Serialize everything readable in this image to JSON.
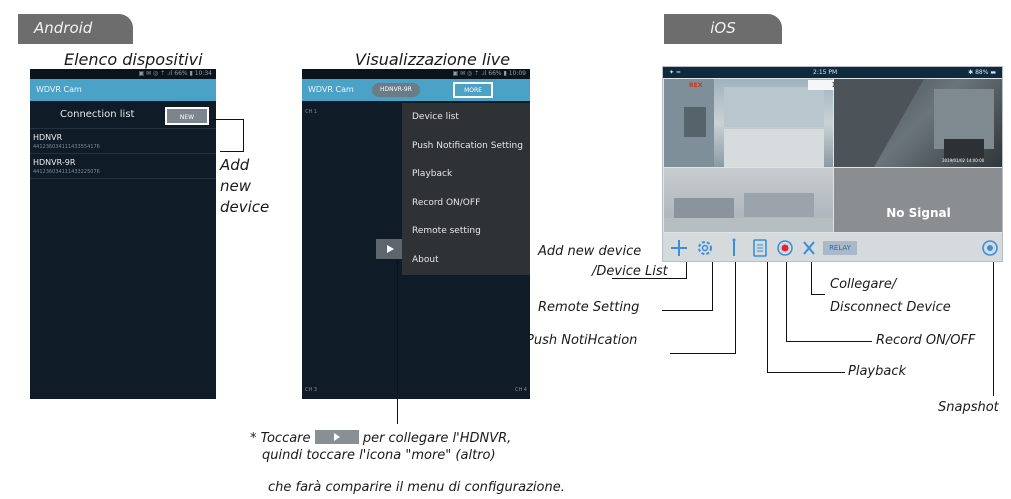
{
  "sections": {
    "android_tab": "Android",
    "ios_tab": "iOS"
  },
  "android_list": {
    "caption": "Elenco dispositivi",
    "statusbar": "▣ ✉ ◎ ⇡ .ıl 66% ▮ 10:34",
    "app_title": "WDVR Cam",
    "header_title": "Connection list",
    "new_button": "NEW",
    "devices": [
      {
        "name": "HDNVR",
        "id": "441236034111433554176"
      },
      {
        "name": "HDNVR-9R",
        "id": "441236034111433225076"
      }
    ],
    "annotation_add": [
      "Add",
      "new",
      "device"
    ]
  },
  "android_live": {
    "caption": "Visualizzazione live",
    "statusbar": "▣ ✉ ◎ ⇡ .ıl 66% ▮ 10:09",
    "app_title": "WDVR Cam",
    "device_pill": "HDNVR-9R",
    "more_button": "MORE",
    "ch_labels": [
      "CH 1",
      "CH 3",
      "CH 4"
    ],
    "menu": [
      "Device list",
      "Push Notification Setting",
      "Playback",
      "Record ON/OFF",
      "Remote setting",
      "About"
    ],
    "note_prefix": "* Toccare",
    "note_suffix": "per collegare l'HDNVR,",
    "note_line2": "quindi toccare l'icona \"more\" (altro)",
    "note_line3": "che farà comparire il menu di configurazione."
  },
  "ios": {
    "status_time": "2:15 PM",
    "status_battery": "✱ 88% ▬",
    "floor_label": "14F",
    "no_signal": "No Signal",
    "cam_timestamp": "2019/01/02 14:00:00",
    "relay": "RELAY",
    "labels": {
      "add_device": "Add new device",
      "device_list": "/Device List",
      "remote_setting": "Remote Setting",
      "push": "Push NotiHcation",
      "collegare": "Collegare/",
      "disconnect": "Disconnect Device",
      "record": "Record ON/OFF",
      "playback": "Playback",
      "snapshot": "Snapshot"
    }
  },
  "colors": {
    "tab_bg": "#6d6d6d",
    "app_blue": "#4aa3c7",
    "phone_dark": "#0f1b26",
    "ios_icon_blue": "#3b8fd9",
    "record_red": "#e0243a"
  }
}
